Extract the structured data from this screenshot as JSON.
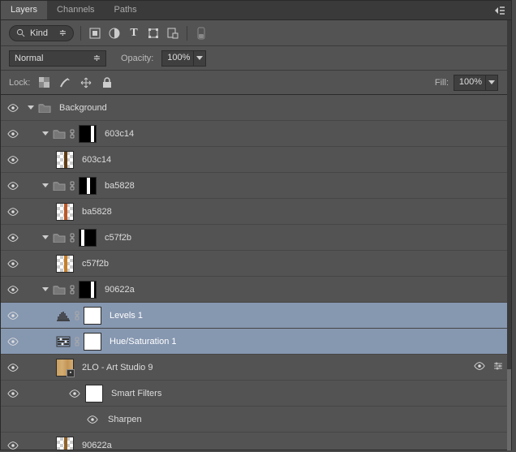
{
  "tabs": {
    "layers": "Layers",
    "channels": "Channels",
    "paths": "Paths"
  },
  "filter": {
    "kind": "Kind"
  },
  "blend": {
    "mode": "Normal",
    "opacity_label": "Opacity:",
    "opacity": "100%"
  },
  "lock": {
    "label": "Lock:",
    "fill_label": "Fill:",
    "fill": "100%"
  },
  "rows": [
    {
      "type": "group",
      "indent": 0,
      "name": "Background",
      "twist": "down",
      "thumb": "folder"
    },
    {
      "type": "group",
      "indent": 1,
      "name": "603c14",
      "twist": "down",
      "thumb": "mask-folder",
      "mask_bg": "#000",
      "mask_stripe": "#fff",
      "stripe_pos": "right"
    },
    {
      "type": "layer",
      "indent": 2,
      "name": "603c14",
      "thumb": "checker",
      "stripe": "#603c14"
    },
    {
      "type": "group",
      "indent": 1,
      "name": "ba5828",
      "twist": "down",
      "thumb": "mask-folder",
      "mask_bg": "#000",
      "mask_stripe": "#fff",
      "stripe_pos": "center"
    },
    {
      "type": "layer",
      "indent": 2,
      "name": "ba5828",
      "thumb": "checker",
      "stripe": "#ba5828"
    },
    {
      "type": "group",
      "indent": 1,
      "name": "c57f2b",
      "twist": "down",
      "thumb": "mask-folder",
      "mask_bg": "#000",
      "mask_stripe": "#fff",
      "stripe_pos": "left"
    },
    {
      "type": "layer",
      "indent": 2,
      "name": "c57f2b",
      "thumb": "checker",
      "stripe": "#c57f2b"
    },
    {
      "type": "group",
      "indent": 1,
      "name": "90622a",
      "twist": "down",
      "thumb": "mask-folder",
      "mask_bg": "#000",
      "mask_stripe": "#fff",
      "stripe_pos": "right"
    },
    {
      "type": "adj",
      "indent": 2,
      "name": "Levels 1",
      "adj": "levels",
      "selected": true
    },
    {
      "type": "adj",
      "indent": 2,
      "name": "Hue/Saturation 1",
      "adj": "huesat",
      "selected": true
    },
    {
      "type": "smart",
      "indent": 2,
      "name": "2LO - Art Studio 9",
      "thumb": "wood",
      "fx": true
    },
    {
      "type": "sf-head",
      "indent": 3,
      "name": "Smart Filters"
    },
    {
      "type": "sf-item",
      "indent": 4,
      "name": "Sharpen"
    },
    {
      "type": "layer",
      "indent": 2,
      "name": "90622a",
      "thumb": "checker",
      "stripe": "#90622a"
    }
  ]
}
